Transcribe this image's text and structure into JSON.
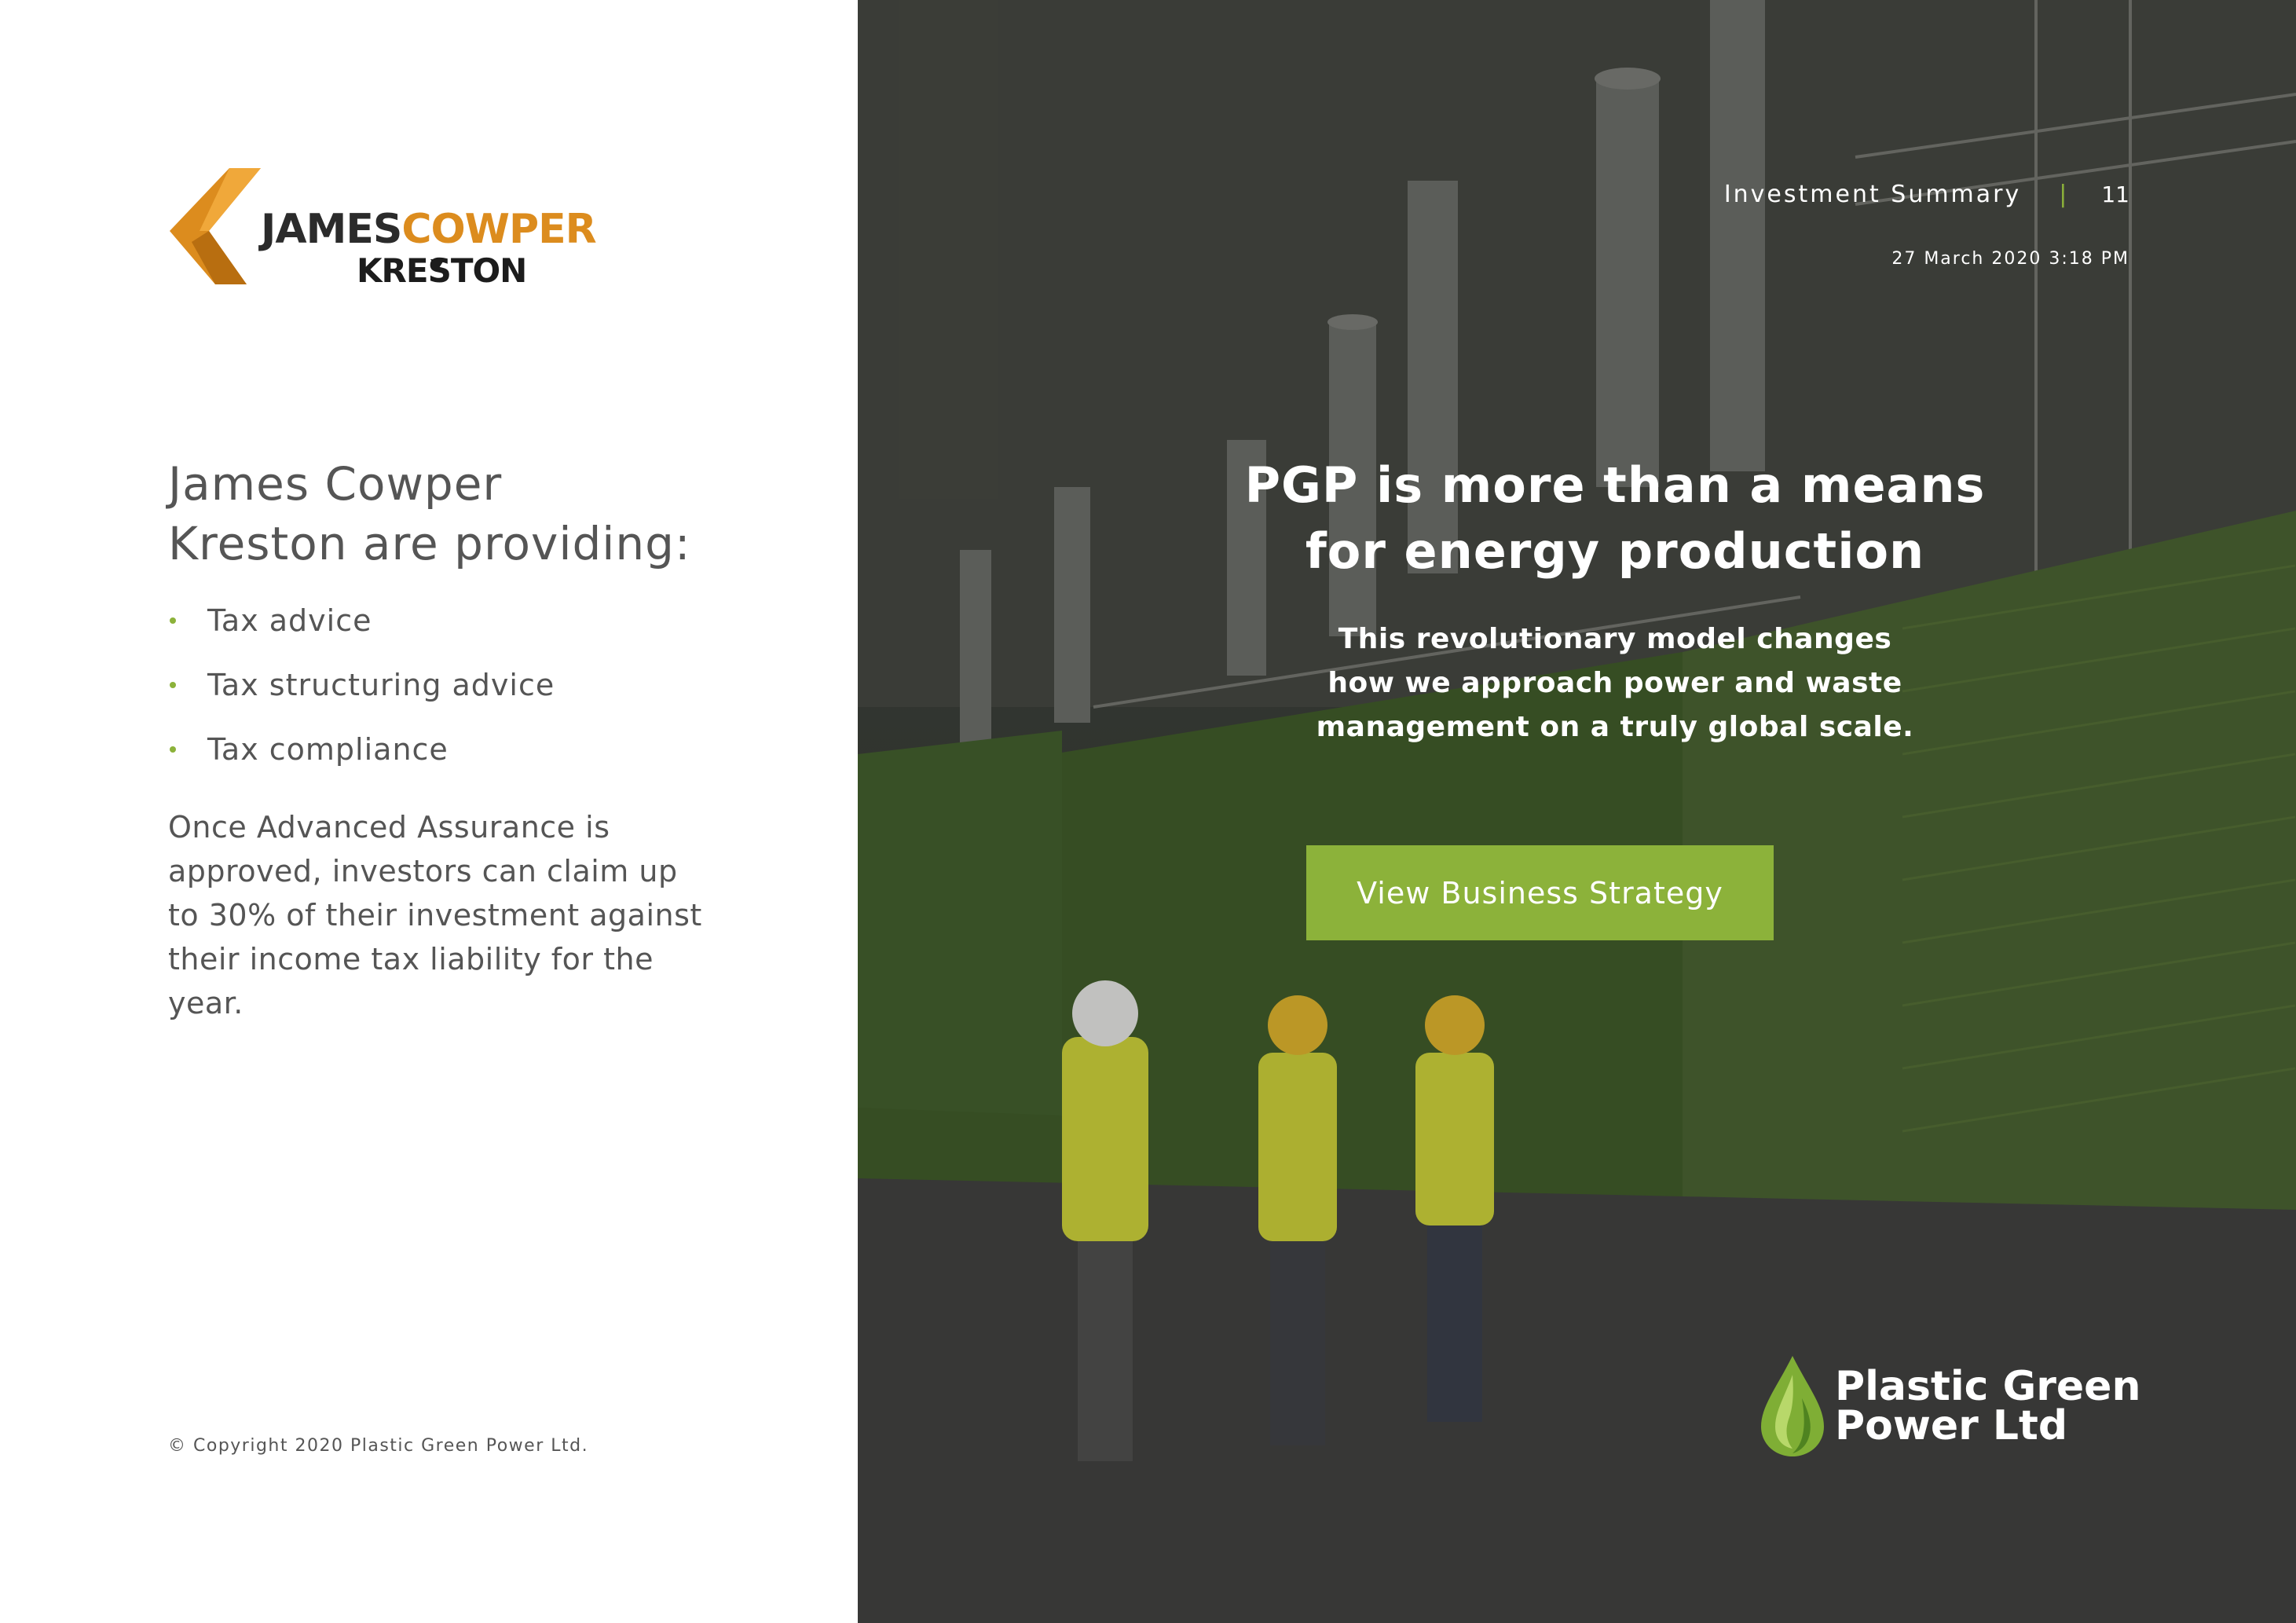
{
  "brand_left": {
    "word_part1": "JAMES",
    "word_part2": "COWPER",
    "word_line2": "KRESTON",
    "accent_color": "#dc8c1e"
  },
  "intro": {
    "heading_line1": "James Cowper",
    "heading_line2": "Kreston are providing:"
  },
  "services": [
    "Tax advice",
    "Tax structuring advice",
    "Tax compliance"
  ],
  "paragraph": "Once Advanced Assurance is approved, investors can claim up to 30% of their investment against their income tax liability for the year.",
  "copyright": "© Copyright 2020 Plastic Green Power Ltd.",
  "header": {
    "section": "Investment Summary",
    "separator": "|",
    "page_number": "11",
    "datetime": "27 March 2020 3:18 PM"
  },
  "hero": {
    "headline_line1": "PGP is more than a means",
    "headline_line2": "for energy production",
    "sub_line1": "This revolutionary model changes",
    "sub_line2": "how we approach power and waste",
    "sub_line3": "management on a truly global scale.",
    "cta_label": "View Business Strategy"
  },
  "brand_right": {
    "name_line1": "Plastic Green",
    "name_line2": "Power Ltd",
    "green": "#8cb23a"
  },
  "colors": {
    "accent_green": "#8cb23a",
    "text_grey": "#555555"
  }
}
